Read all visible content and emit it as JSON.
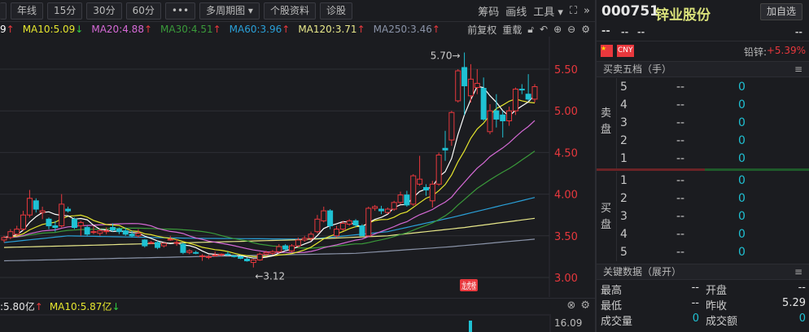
{
  "toolbar": {
    "items": [
      "年线",
      "15分",
      "30分",
      "60分",
      "•••",
      "多周期图 ▾",
      "个股资料",
      "诊股"
    ],
    "right": [
      "筹码",
      "画线",
      "工具 ▾"
    ],
    "expand_icon": "⛶",
    "more_icon": "»"
  },
  "ma_legend": [
    {
      "text": "9",
      "arrow": "↑",
      "dir": "up",
      "color": "#ffffff"
    },
    {
      "text": "MA10:5.09",
      "arrow": "↓",
      "dir": "dn",
      "color": "#e6e62e"
    },
    {
      "text": "MA20:4.88",
      "arrow": "↑",
      "dir": "up",
      "color": "#d66ad6"
    },
    {
      "text": "MA30:4.51",
      "arrow": "↑",
      "dir": "up",
      "color": "#3a9a3a"
    },
    {
      "text": "MA60:3.96",
      "arrow": "↑",
      "dir": "up",
      "color": "#2aa0d8"
    },
    {
      "text": "MA120:3.71",
      "arrow": "↑",
      "dir": "up",
      "color": "#e8e88a"
    },
    {
      "text": "MA250:3.46",
      "arrow": "↑",
      "dir": "up",
      "color": "#8a93a8"
    }
  ],
  "ma_right": {
    "adjust": "前复权",
    "reload": "重载"
  },
  "colors": {
    "up": "#e8383d",
    "down": "#1fc1d3",
    "bg": "#1b1c20"
  },
  "chart_data": {
    "type": "candlestick",
    "yticks": [
      "5.50",
      "5.00",
      "4.50",
      "4.00",
      "3.50",
      "3.00"
    ],
    "ylim": [
      2.92,
      5.75
    ],
    "annotations": {
      "high": "5.70→",
      "low": "←3.12",
      "badge": "龙虎榜"
    },
    "ohlc": [
      [
        3.45,
        3.5,
        3.42,
        3.48
      ],
      [
        3.48,
        3.58,
        3.46,
        3.55
      ],
      [
        3.52,
        3.62,
        3.5,
        3.58
      ],
      [
        3.58,
        3.8,
        3.56,
        3.75
      ],
      [
        3.75,
        4.05,
        3.72,
        3.95
      ],
      [
        3.92,
        3.95,
        3.78,
        3.82
      ],
      [
        3.78,
        3.85,
        3.7,
        3.8
      ],
      [
        3.7,
        3.72,
        3.58,
        3.62
      ],
      [
        3.62,
        3.68,
        3.55,
        3.6
      ],
      [
        3.62,
        4.0,
        3.6,
        3.88
      ],
      [
        3.82,
        3.85,
        3.78,
        3.8
      ],
      [
        3.7,
        3.72,
        3.58,
        3.6
      ],
      [
        3.62,
        3.68,
        3.5,
        3.66
      ],
      [
        3.6,
        3.62,
        3.5,
        3.52
      ],
      [
        3.55,
        3.62,
        3.52,
        3.55
      ],
      [
        3.53,
        3.58,
        3.5,
        3.56
      ],
      [
        3.55,
        3.6,
        3.52,
        3.56
      ],
      [
        3.6,
        3.65,
        3.55,
        3.57
      ],
      [
        3.58,
        3.6,
        3.52,
        3.55
      ],
      [
        3.56,
        3.6,
        3.5,
        3.52
      ],
      [
        3.52,
        3.56,
        3.48,
        3.5
      ],
      [
        3.5,
        3.58,
        3.48,
        3.53
      ],
      [
        3.45,
        3.46,
        3.36,
        3.38
      ],
      [
        3.42,
        3.44,
        3.4,
        3.42
      ],
      [
        3.42,
        3.44,
        3.34,
        3.36
      ],
      [
        3.38,
        3.42,
        3.36,
        3.41
      ],
      [
        3.45,
        3.5,
        3.44,
        3.46
      ],
      [
        3.42,
        3.46,
        3.38,
        3.42
      ],
      [
        3.4,
        3.42,
        3.28,
        3.3
      ],
      [
        3.3,
        3.34,
        3.28,
        3.32
      ],
      [
        3.3,
        3.32,
        3.28,
        3.29
      ],
      [
        3.25,
        3.28,
        3.2,
        3.26
      ],
      [
        3.24,
        3.27,
        3.22,
        3.25
      ],
      [
        3.27,
        3.31,
        3.25,
        3.27
      ],
      [
        3.27,
        3.29,
        3.25,
        3.28
      ],
      [
        3.28,
        3.31,
        3.26,
        3.27
      ],
      [
        3.26,
        3.27,
        3.24,
        3.25
      ],
      [
        3.25,
        3.26,
        3.22,
        3.23
      ],
      [
        3.22,
        3.24,
        3.19,
        3.2
      ],
      [
        3.18,
        3.22,
        3.12,
        3.21
      ],
      [
        3.21,
        3.3,
        3.2,
        3.28
      ],
      [
        3.28,
        3.32,
        3.26,
        3.3
      ],
      [
        3.29,
        3.33,
        3.27,
        3.31
      ],
      [
        3.31,
        3.4,
        3.29,
        3.37
      ],
      [
        3.38,
        3.4,
        3.32,
        3.34
      ],
      [
        3.32,
        3.4,
        3.3,
        3.38
      ],
      [
        3.38,
        3.48,
        3.36,
        3.45
      ],
      [
        3.45,
        3.5,
        3.43,
        3.47
      ],
      [
        3.47,
        3.55,
        3.44,
        3.52
      ],
      [
        3.55,
        3.75,
        3.53,
        3.7
      ],
      [
        3.68,
        3.85,
        3.66,
        3.8
      ],
      [
        3.8,
        3.82,
        3.58,
        3.62
      ],
      [
        3.5,
        3.62,
        3.48,
        3.58
      ],
      [
        3.58,
        3.68,
        3.56,
        3.65
      ],
      [
        3.64,
        3.7,
        3.62,
        3.68
      ],
      [
        3.68,
        3.7,
        3.6,
        3.63
      ],
      [
        3.62,
        3.64,
        3.5,
        3.5
      ],
      [
        3.5,
        3.85,
        3.5,
        3.83
      ],
      [
        3.83,
        3.87,
        3.8,
        3.85
      ],
      [
        3.82,
        3.86,
        3.76,
        3.8
      ],
      [
        3.78,
        3.84,
        3.76,
        3.82
      ],
      [
        3.82,
        3.92,
        3.8,
        3.9
      ],
      [
        3.9,
        4.03,
        3.88,
        3.99
      ],
      [
        3.99,
        4.04,
        3.85,
        3.87
      ],
      [
        3.88,
        4.24,
        3.86,
        4.22
      ],
      [
        4.12,
        4.46,
        4.1,
        4.18
      ],
      [
        4.08,
        4.12,
        3.98,
        4.05
      ],
      [
        3.92,
        4.16,
        3.84,
        4.12
      ],
      [
        4.12,
        4.5,
        4.1,
        4.47
      ],
      [
        4.55,
        4.76,
        4.4,
        4.53
      ],
      [
        4.65,
        5.0,
        4.58,
        4.98
      ],
      [
        5.12,
        5.5,
        5.1,
        5.48
      ],
      [
        5.52,
        5.7,
        4.95,
        5.3
      ],
      [
        5.18,
        5.56,
        5.1,
        5.38
      ],
      [
        5.28,
        5.5,
        5.2,
        5.33
      ],
      [
        5.27,
        5.4,
        4.88,
        4.9
      ],
      [
        4.75,
        5.08,
        4.72,
        5.0
      ],
      [
        5.0,
        5.2,
        4.8,
        4.9
      ],
      [
        4.95,
        5.0,
        4.68,
        4.88
      ],
      [
        4.88,
        5.05,
        4.82,
        5.0
      ],
      [
        5.0,
        5.28,
        4.95,
        5.26
      ],
      [
        5.26,
        5.32,
        5.2,
        5.25
      ],
      [
        5.2,
        5.44,
        5.12,
        5.14
      ],
      [
        5.14,
        5.32,
        5.1,
        5.29
      ]
    ],
    "ma_computed": [
      {
        "name": "MA5",
        "period": 5,
        "color": "#ffffff"
      },
      {
        "name": "MA10",
        "period": 10,
        "color": "#e6e62e"
      },
      {
        "name": "MA20",
        "period": 20,
        "color": "#d66ad6"
      },
      {
        "name": "MA30",
        "period": 30,
        "color": "#3a9a3a"
      }
    ],
    "ma_anchors": [
      {
        "name": "MA60",
        "color": "#2aa0d8",
        "points": [
          [
            0,
            3.42
          ],
          [
            10,
            3.5
          ],
          [
            30,
            3.47
          ],
          [
            48,
            3.46
          ],
          [
            60,
            3.55
          ],
          [
            70,
            3.72
          ],
          [
            83,
            3.96
          ]
        ]
      },
      {
        "name": "MA120",
        "color": "#e8e88a",
        "points": [
          [
            0,
            3.36
          ],
          [
            20,
            3.4
          ],
          [
            45,
            3.45
          ],
          [
            60,
            3.5
          ],
          [
            72,
            3.6
          ],
          [
            83,
            3.71
          ]
        ]
      },
      {
        "name": "MA250",
        "color": "#8a93a8",
        "points": [
          [
            0,
            3.2
          ],
          [
            30,
            3.25
          ],
          [
            55,
            3.29
          ],
          [
            70,
            3.37
          ],
          [
            83,
            3.46
          ]
        ]
      }
    ]
  },
  "volume": {
    "legend": [
      {
        "text": ":5.80亿",
        "arrow": "↑",
        "dir": "up",
        "color": "#e6e6e6"
      },
      {
        "text": "MA10:5.87亿",
        "arrow": "↓",
        "dir": "dn",
        "color": "#e6e62e"
      }
    ],
    "axis_top": "16.09"
  },
  "stock": {
    "code": "000751",
    "name": "锌业股份",
    "add_watch": "加自选",
    "quote_placeholders": [
      "--",
      "--",
      "--"
    ],
    "right_placeholder": "--",
    "currency": "CNY",
    "sector": "铅锌:",
    "sector_change": "+5.39%"
  },
  "orderbook": {
    "title": "买卖五档（手）",
    "sell_label": "卖盘",
    "buy_label": "买盘",
    "sell": [
      {
        "lvl": "5",
        "price": "--",
        "vol": "0"
      },
      {
        "lvl": "4",
        "price": "--",
        "vol": "0"
      },
      {
        "lvl": "3",
        "price": "--",
        "vol": "0"
      },
      {
        "lvl": "2",
        "price": "--",
        "vol": "0"
      },
      {
        "lvl": "1",
        "price": "--",
        "vol": "0"
      }
    ],
    "buy": [
      {
        "lvl": "1",
        "price": "--",
        "vol": "0"
      },
      {
        "lvl": "2",
        "price": "--",
        "vol": "0"
      },
      {
        "lvl": "3",
        "price": "--",
        "vol": "0"
      },
      {
        "lvl": "4",
        "price": "--",
        "vol": "0"
      },
      {
        "lvl": "5",
        "price": "--",
        "vol": "0"
      }
    ]
  },
  "keydata": {
    "title": "关键数据（展开）",
    "rows": [
      {
        "l1": "最高",
        "v1": "--",
        "l2": "开盘",
        "v2": "--",
        "c": ""
      },
      {
        "l1": "最低",
        "v1": "--",
        "l2": "昨收",
        "v2": "5.29",
        "c": ""
      },
      {
        "l1": "成交量",
        "v1": "0",
        "l2": "成交额",
        "v2": "0",
        "c": "cyan"
      }
    ]
  }
}
